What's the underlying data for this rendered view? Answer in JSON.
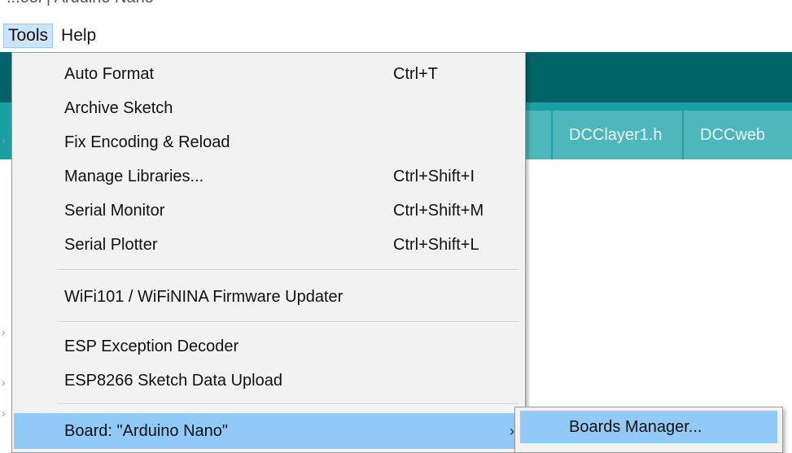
{
  "window": {
    "title_fragment": "...ool | Arduino Nano"
  },
  "menubar": {
    "items": [
      {
        "label": "Tools"
      },
      {
        "label": "Help"
      }
    ]
  },
  "background": {
    "tabs": [
      {
        "label": ""
      },
      {
        "label": "DCClayer1.h"
      },
      {
        "label": "DCCweb"
      }
    ]
  },
  "tools_menu": {
    "items": [
      {
        "label": "Auto Format",
        "shortcut": "Ctrl+T"
      },
      {
        "label": "Archive Sketch",
        "shortcut": ""
      },
      {
        "label": "Fix Encoding & Reload",
        "shortcut": ""
      },
      {
        "label": "Manage Libraries...",
        "shortcut": "Ctrl+Shift+I"
      },
      {
        "label": "Serial Monitor",
        "shortcut": "Ctrl+Shift+M"
      },
      {
        "label": "Serial Plotter",
        "shortcut": "Ctrl+Shift+L"
      },
      {
        "label": "WiFi101 / WiFiNINA Firmware Updater",
        "shortcut": ""
      },
      {
        "label": "ESP Exception Decoder",
        "shortcut": ""
      },
      {
        "label": "ESP8266 Sketch Data Upload",
        "shortcut": ""
      },
      {
        "label": "Board: \"Arduino Nano\"",
        "shortcut": "",
        "submenu_arrow": "›"
      }
    ]
  },
  "board_submenu": {
    "items": [
      {
        "label": "Boards Manager..."
      }
    ]
  },
  "colors": {
    "ide_toolbar": "#006468",
    "ide_tabstrip": "#17a1a5",
    "ide_tab": "#4db7bb",
    "menu_bg": "#f2f2f2",
    "menu_highlight": "#91c9f7"
  }
}
